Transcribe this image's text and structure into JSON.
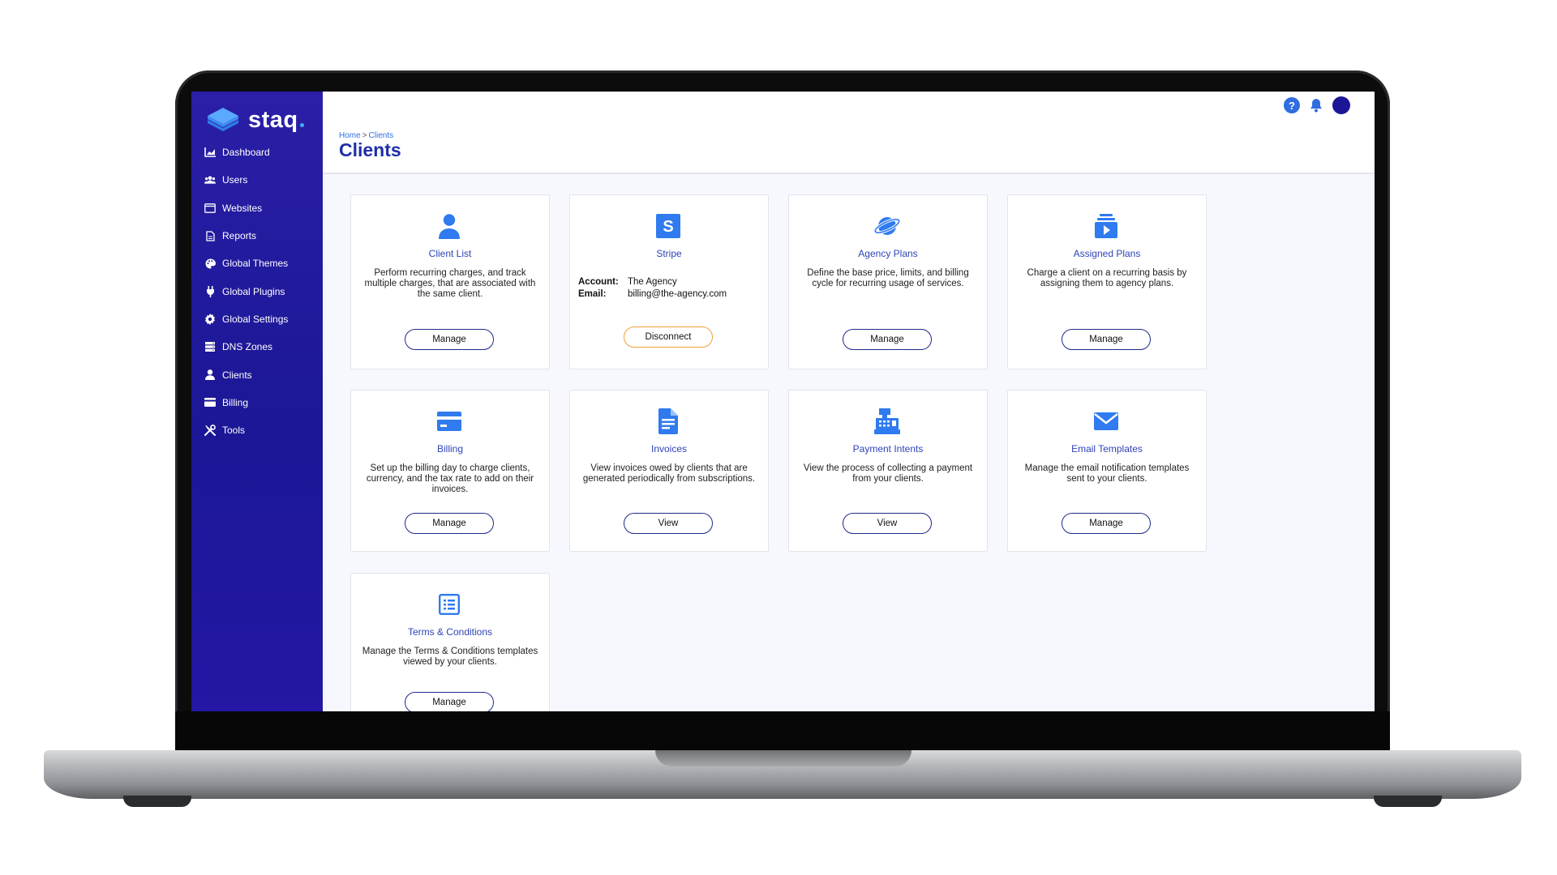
{
  "brand": {
    "name": "staq",
    "colors": {
      "sidebar": "#1b1796",
      "accent": "#2f6de0",
      "title": "#1f2fa8",
      "orange": "#f0a23a"
    }
  },
  "sidebar": {
    "items": [
      {
        "label": "Dashboard",
        "icon": "chart-icon"
      },
      {
        "label": "Users",
        "icon": "users-icon"
      },
      {
        "label": "Websites",
        "icon": "window-icon"
      },
      {
        "label": "Reports",
        "icon": "file-icon"
      },
      {
        "label": "Global Themes",
        "icon": "palette-icon"
      },
      {
        "label": "Global Plugins",
        "icon": "plug-icon"
      },
      {
        "label": "Global Settings",
        "icon": "gear-icon"
      },
      {
        "label": "DNS Zones",
        "icon": "server-icon"
      },
      {
        "label": "Clients",
        "icon": "user-icon"
      },
      {
        "label": "Billing",
        "icon": "credit-card-icon"
      },
      {
        "label": "Tools",
        "icon": "tools-icon"
      }
    ]
  },
  "topbar": {
    "help_label": "?"
  },
  "header": {
    "breadcrumb": [
      "Home",
      "Clients"
    ],
    "breadcrumb_sep": ">",
    "title": "Clients"
  },
  "cards": [
    {
      "title": "Client List",
      "icon": "user-icon",
      "description": "Perform recurring charges, and track multiple charges, that are associated with the same client.",
      "button": "Manage"
    },
    {
      "title": "Stripe",
      "icon": "stripe-icon",
      "account_label": "Account:",
      "account_value": "The Agency",
      "email_label": "Email:",
      "email_value": "billing@the-agency.com",
      "button": "Disconnect"
    },
    {
      "title": "Agency Plans",
      "icon": "planet-icon",
      "description": "Define the base price, limits, and billing cycle for recurring usage of services.",
      "button": "Manage"
    },
    {
      "title": "Assigned Plans",
      "icon": "stack-play-icon",
      "description": "Charge a client on a recurring basis by assigning them to agency plans.",
      "button": "Manage"
    },
    {
      "title": "Billing",
      "icon": "credit-card-icon",
      "description": "Set up the billing day to charge clients, currency, and the tax rate to add on their invoices.",
      "button": "Manage"
    },
    {
      "title": "Invoices",
      "icon": "invoice-icon",
      "description": "View invoices owed by clients that are generated periodically from subscriptions.",
      "button": "View"
    },
    {
      "title": "Payment Intents",
      "icon": "cash-register-icon",
      "description": "View the process of collecting a payment from your clients.",
      "button": "View"
    },
    {
      "title": "Email Templates",
      "icon": "envelope-icon",
      "description": "Manage the email notification templates sent to your clients.",
      "button": "Manage"
    },
    {
      "title": "Terms & Conditions",
      "icon": "list-icon",
      "description": "Manage the Terms & Conditions templates viewed by your clients.",
      "button": "Manage"
    }
  ]
}
